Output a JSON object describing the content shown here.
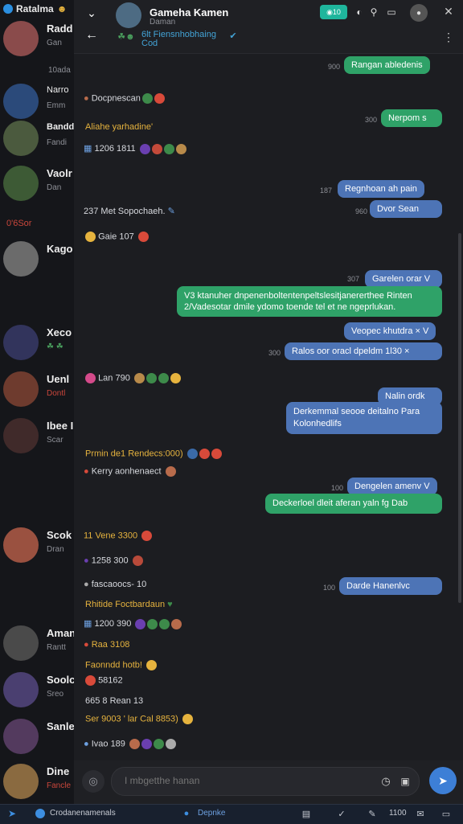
{
  "sidebar": {
    "title": "Ratalma",
    "items": [
      {
        "name": "Radd",
        "sub": "Gan",
        "avatar": "#8a4b4b",
        "top": 0
      },
      {
        "name": "",
        "sub": "10ada",
        "avatar": "#1b1c20",
        "top": 0
      },
      {
        "name": "Narro",
        "sub": "Emm",
        "avatar": "#2b4a7a",
        "top": 0
      },
      {
        "name": "Bandd",
        "sub": "Fandi",
        "avatar": "#4b5a3e",
        "top": 0
      },
      {
        "name": "Vaolr",
        "sub": "Dan",
        "avatar": "#3d5a35",
        "top": 0
      },
      {
        "name": "Kago",
        "sub": "",
        "avatar": "#6b6b6b",
        "top": 0
      },
      {
        "name": "Xeco",
        "sub": "",
        "avatar": "#32345c",
        "top": 0
      },
      {
        "name": "Uenl",
        "sub": "Dontl",
        "avatar": "#6e3b2e",
        "top": 0
      },
      {
        "name": "Ibee I",
        "sub": "Scar",
        "avatar": "#402a2a",
        "top": 0
      },
      {
        "name": "Scok",
        "sub": "Dran",
        "avatar": "#9a5140",
        "top": 0
      },
      {
        "name": "Aman",
        "sub": "Rantt",
        "avatar": "#4a4a4a",
        "top": 0
      },
      {
        "name": "Soolc",
        "sub": "Sreo",
        "avatar": "#4a3f70",
        "top": 0
      },
      {
        "name": "Sanle",
        "sub": "",
        "avatar": "#533a5e",
        "top": 0
      },
      {
        "name": "Dine",
        "sub": "Fancle",
        "avatar": "#8a6a40",
        "top": 0
      }
    ],
    "section_label": "0'6Sor"
  },
  "header": {
    "name": "Gameha Kamen",
    "sub": "Daman",
    "sub2_line1": "6lt Fiensnhobhaing",
    "sub2_line2": "Cod",
    "badge": "10"
  },
  "messages": {
    "m1": {
      "text": "Rangan abledenis",
      "time": "900"
    },
    "l1": {
      "text": "Docpnescan"
    },
    "l2": {
      "text": "Aliahe yarhadine'"
    },
    "l3": {
      "text": "1206  1811"
    },
    "m2": {
      "text": "Nerpom  s",
      "time": "300"
    },
    "m3": {
      "text": "Regnhoan ah pain",
      "time": "187"
    },
    "m4": {
      "text": "Dvor Sean",
      "time": "960"
    },
    "l4": {
      "text": "237  Met Sopochaeh."
    },
    "l5": {
      "text": "Gaie  107"
    },
    "m5": {
      "text": "Garelen orar  V",
      "time": "307"
    },
    "m6": {
      "text": "V3 ktanuher dnpenenboltentenpeltslesitjanererthee  Rinten 2/Vadesotar dmile ydomo toende tel et ne ngeprlukan."
    },
    "m7": {
      "text": "Veopec khutdra  ×  V"
    },
    "m8": {
      "text": "Ralos oor oracl dpeldm 1l30  ×",
      "time": "300"
    },
    "l6": {
      "text": "Lan  790"
    },
    "m9": {
      "text": "Nalin ordk"
    },
    "m10": {
      "text": "Derkemmal seooe  deitalno Para Kolonhedlifs"
    },
    "l7": {
      "text": "Prmin de1  Rendecs:000)"
    },
    "l8": {
      "text": "Kerry aonhenaect"
    },
    "m11": {
      "text": "Dengelen amenv  V",
      "time": "100"
    },
    "m12": {
      "text": "Deckerloel dleit aferan yaln fg  Dab"
    },
    "l9": {
      "text": "11  Vene  3300"
    },
    "l10": {
      "text": "1258  300"
    },
    "l11": {
      "text": "fascaoocs-  10"
    },
    "m13": {
      "text": "Darde Hanenlvc",
      "time": "100"
    },
    "l12": {
      "text": "Rhitide Foctbardaun"
    },
    "l13": {
      "text": "1200  390"
    },
    "l14": {
      "text": "Raa  3108"
    },
    "l15": {
      "text": "Faonndd hotb!"
    },
    "l16": {
      "text": "58162"
    },
    "l17": {
      "text": "665 8  Rean  13"
    },
    "l18": {
      "text": "Ser  9003  '  lar  Cal  8853)"
    },
    "l19": {
      "text": "Ivao  189"
    }
  },
  "input": {
    "placeholder": "I mbgetthe hanan"
  },
  "taskbar": {
    "left": "Crodanenamenals",
    "center": "Depnke",
    "time": "1100"
  },
  "colors": {
    "accent": "#2fa268",
    "blue_bubble": "#4d74b6",
    "link": "#43a3d6"
  }
}
